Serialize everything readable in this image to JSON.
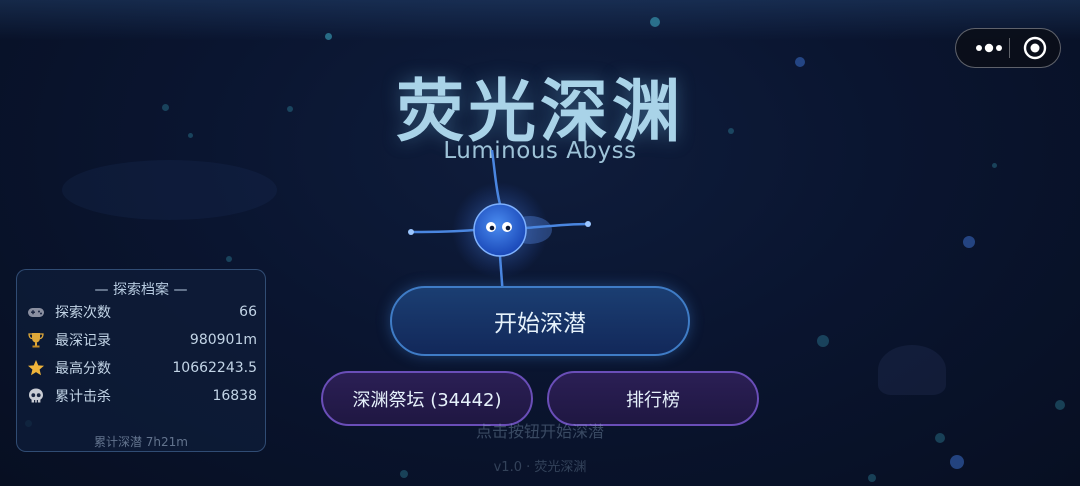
{
  "title": {
    "cn": "荧光深渊",
    "en": "Luminous Abyss"
  },
  "capsule": {
    "more_icon": "more-dots-icon",
    "close_icon": "target-circle-icon"
  },
  "buttons": {
    "start": "开始深潜",
    "altar": "深渊祭坛 (34442)",
    "leaderboard": "排行榜"
  },
  "hint": "点击按钮开始深潜",
  "version": "v1.0 · 荧光深渊",
  "stats_panel": {
    "title": "— 探索档案 —",
    "rows": [
      {
        "icon": "gamepad-icon",
        "label": "探索次数",
        "value": "66"
      },
      {
        "icon": "trophy-icon",
        "label": "最深记录",
        "value": "980901m"
      },
      {
        "icon": "star-icon",
        "label": "最高分数",
        "value": "10662243.5"
      },
      {
        "icon": "skull-icon",
        "label": "累计击杀",
        "value": "16838"
      }
    ],
    "footer": "累计深潜 7h21m"
  },
  "colors": {
    "background": "#0a1530",
    "title": "#a9d3e8",
    "start_border": "#3f7cc6",
    "secondary_border": "#6a4eb8",
    "panel_border": "#50789a"
  }
}
